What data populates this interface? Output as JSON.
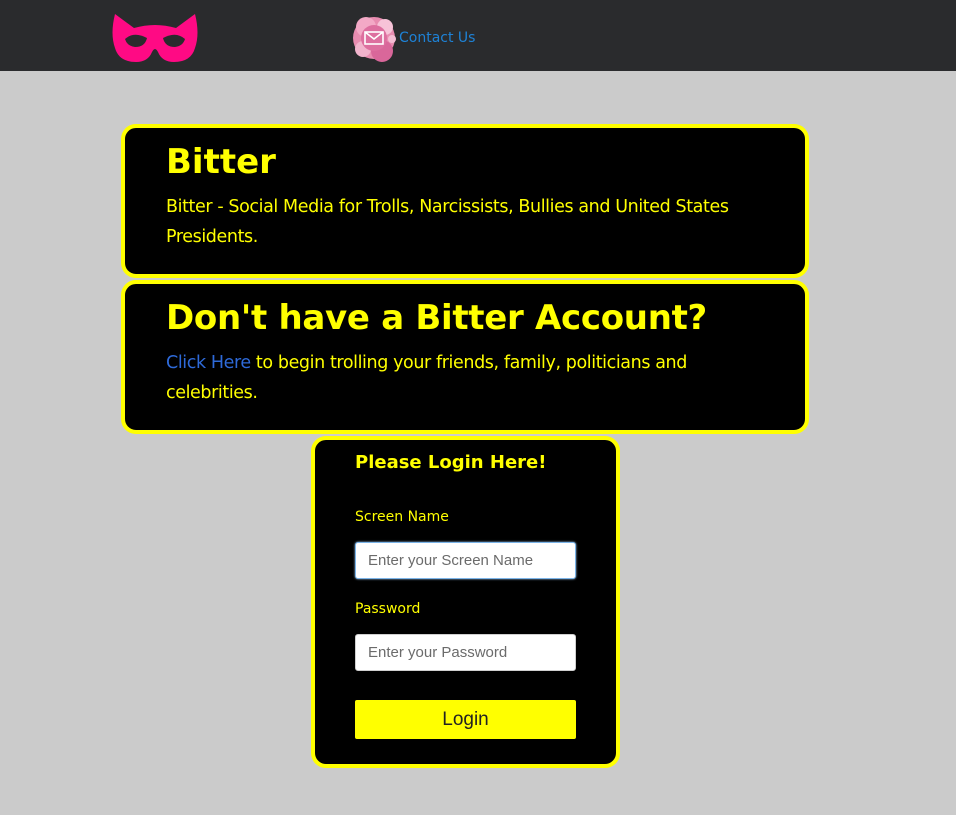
{
  "nav": {
    "contact_label": "Contact Us"
  },
  "intro": {
    "title": "Bitter",
    "text": "Bitter - Social Media for Trolls, Narcissists, Bullies and United States Presidents."
  },
  "signup": {
    "title": "Don't have a Bitter Account?",
    "link_text": "Click Here",
    "text_after_link": " to begin trolling your friends, family, politicians and celebrities."
  },
  "login": {
    "title": "Please Login Here!",
    "screen_name_label": "Screen Name",
    "screen_name_placeholder": "Enter your Screen Name",
    "screen_name_value": "",
    "password_label": "Password",
    "password_placeholder": "Enter your Password",
    "password_value": "",
    "button_label": "Login"
  },
  "colors": {
    "accent": "#ffff00",
    "logo": "#ff0a84",
    "link": "#2e6ad9",
    "contact_link": "#1e82d6",
    "navbar": "#2a2b2d",
    "background": "#cbcbcb"
  },
  "icons": {
    "logo": "cat-mask-icon",
    "contact": "envelope-icon"
  }
}
